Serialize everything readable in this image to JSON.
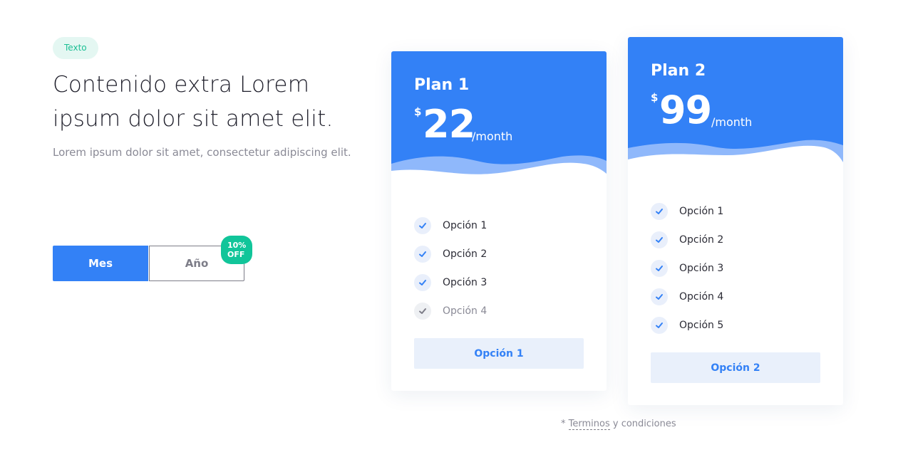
{
  "intro": {
    "tag": "Texto",
    "heading": "Contenido extra Lorem ipsum dolor sit amet elit.",
    "description": "Lorem ipsum dolor sit amet, consectetur adipiscing elit."
  },
  "toggle": {
    "monthly_label": "Mes",
    "yearly_label": "Año",
    "discount_badge": "10% OFF",
    "active": "Mes"
  },
  "plans": [
    {
      "name": "Plan 1",
      "currency": "$",
      "price": "22",
      "period": "/month",
      "features": [
        {
          "label": "Opción 1",
          "enabled": true
        },
        {
          "label": "Opción 2",
          "enabled": true
        },
        {
          "label": "Opción 3",
          "enabled": true
        },
        {
          "label": "Opción 4",
          "enabled": false
        }
      ],
      "cta_label": "Opción 1"
    },
    {
      "name": "Plan 2",
      "currency": "$",
      "price": "99",
      "period": "/month",
      "features": [
        {
          "label": "Opción 1",
          "enabled": true
        },
        {
          "label": "Opción 2",
          "enabled": true
        },
        {
          "label": "Opción 3",
          "enabled": true
        },
        {
          "label": "Opción 4",
          "enabled": true
        },
        {
          "label": "Opción 5",
          "enabled": true
        }
      ],
      "cta_label": "Opción 2"
    }
  ],
  "terms": {
    "prefix": "* ",
    "link_label": "Terminos",
    "suffix": " y condiciones"
  },
  "colors": {
    "primary": "#3381f6",
    "accent_green": "#11c59a",
    "tag_bg": "#e4f7f2",
    "muted_text": "#8a8a96"
  }
}
